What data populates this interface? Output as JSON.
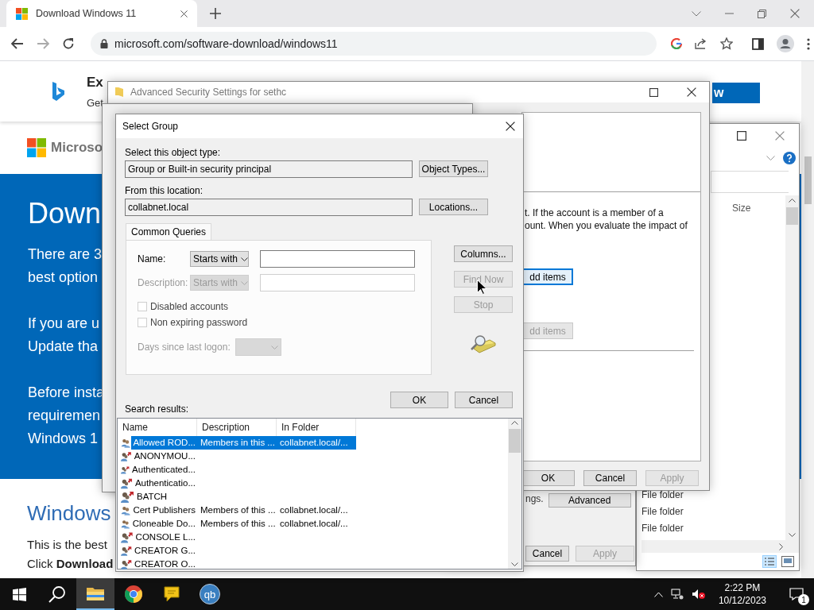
{
  "browser": {
    "tab": {
      "title": "Download Windows 11",
      "selected": true
    },
    "url": "microsoft.com/software-download/windows11"
  },
  "page": {
    "banner": {
      "title": "Ex",
      "subtitle": "Get",
      "button": "w"
    },
    "brand": "Microso",
    "hero": {
      "heading": "Down",
      "paragraphs": [
        [
          "There are 3",
          "best option"
        ],
        [
          "If you are u",
          "Update tha"
        ],
        [
          "Before insta",
          "requiremen",
          "Windows 1"
        ]
      ]
    },
    "section_heading": "Windows",
    "lines": [
      "This is the best",
      "Click **Download**"
    ]
  },
  "explorer_window": {
    "column_header": "Size",
    "rows": [
      "File folder",
      "File folder",
      "File folder"
    ]
  },
  "properties_window": {
    "text": "ngs.",
    "advanced_button": "Advanced",
    "buttons": [
      {
        "label": "Cancel",
        "disabled": false
      },
      {
        "label": "Apply",
        "disabled": true
      }
    ]
  },
  "advanced_security_window": {
    "title": "Advanced Security Settings for sethc",
    "text_lines": [
      "t. If the account is a member of a",
      "ount. When you evaluate the impact of"
    ],
    "add_buttons": [
      {
        "label": "dd items",
        "focused": true,
        "disabled": false
      },
      {
        "label": "dd items",
        "focused": false,
        "disabled": true
      }
    ],
    "buttons": [
      {
        "label": "OK",
        "disabled": false
      },
      {
        "label": "Cancel",
        "disabled": false
      },
      {
        "label": "Apply",
        "disabled": true
      }
    ]
  },
  "select_group": {
    "title": "Select Group",
    "object_type_label": "Select this object type:",
    "object_type": "Group or Built-in security principal",
    "object_types_button": "Object Types...",
    "location_label": "From this location:",
    "location": "collabnet.local",
    "locations_button": "Locations...",
    "tabs": [
      {
        "label": "Common Queries",
        "selected": true
      }
    ],
    "queries": [
      {
        "label": "Name:",
        "operator": "Starts with",
        "disabled": false
      },
      {
        "label": "Description:",
        "operator": "Starts with",
        "disabled": true
      }
    ],
    "checkboxes": [
      {
        "label": "Disabled accounts",
        "checked": false
      },
      {
        "label": "Non expiring password",
        "checked": false
      }
    ],
    "days": {
      "label": "Days since last logon:",
      "disabled": true
    },
    "side_buttons": [
      {
        "label": "Columns...",
        "disabled": false
      },
      {
        "label": "Find Now",
        "disabled": true
      },
      {
        "label": "Stop",
        "disabled": true
      }
    ],
    "ok_button": "OK",
    "cancel_button": "Cancel",
    "results_label": "Search results:",
    "results": {
      "columns": [
        "Name",
        "Description",
        "In Folder"
      ],
      "rows": [
        {
          "name": "Allowed ROD...",
          "description": "Members in this ...",
          "folder": "collabnet.local/...",
          "kind": "group",
          "selected": true
        },
        {
          "name": "ANONYMOU...",
          "kind": "principal",
          "selected": false
        },
        {
          "name": "Authenticated...",
          "kind": "principal",
          "selected": false
        },
        {
          "name": "Authenticatio...",
          "kind": "principal",
          "selected": false
        },
        {
          "name": "BATCH",
          "kind": "principal",
          "selected": false
        },
        {
          "name": "Cert Publishers",
          "description": "Members of this ...",
          "folder": "collabnet.local/...",
          "kind": "group",
          "selected": false
        },
        {
          "name": "Cloneable Do...",
          "description": "Members of this ...",
          "folder": "collabnet.local/...",
          "kind": "group",
          "selected": false
        },
        {
          "name": "CONSOLE L...",
          "kind": "principal",
          "selected": false
        },
        {
          "name": "CREATOR G...",
          "kind": "principal",
          "selected": false
        },
        {
          "name": "CREATOR O...",
          "kind": "principal",
          "selected": false
        }
      ]
    }
  },
  "taskbar": {
    "apps": [
      {
        "kind": "explorer",
        "selected": true
      },
      {
        "kind": "chrome",
        "selected": false
      },
      {
        "kind": "chat",
        "selected": false
      },
      {
        "kind": "lettered",
        "label": "qb",
        "selected": false
      }
    ],
    "time": "2:22 PM",
    "date": "10/12/2023",
    "notifications": "1"
  }
}
